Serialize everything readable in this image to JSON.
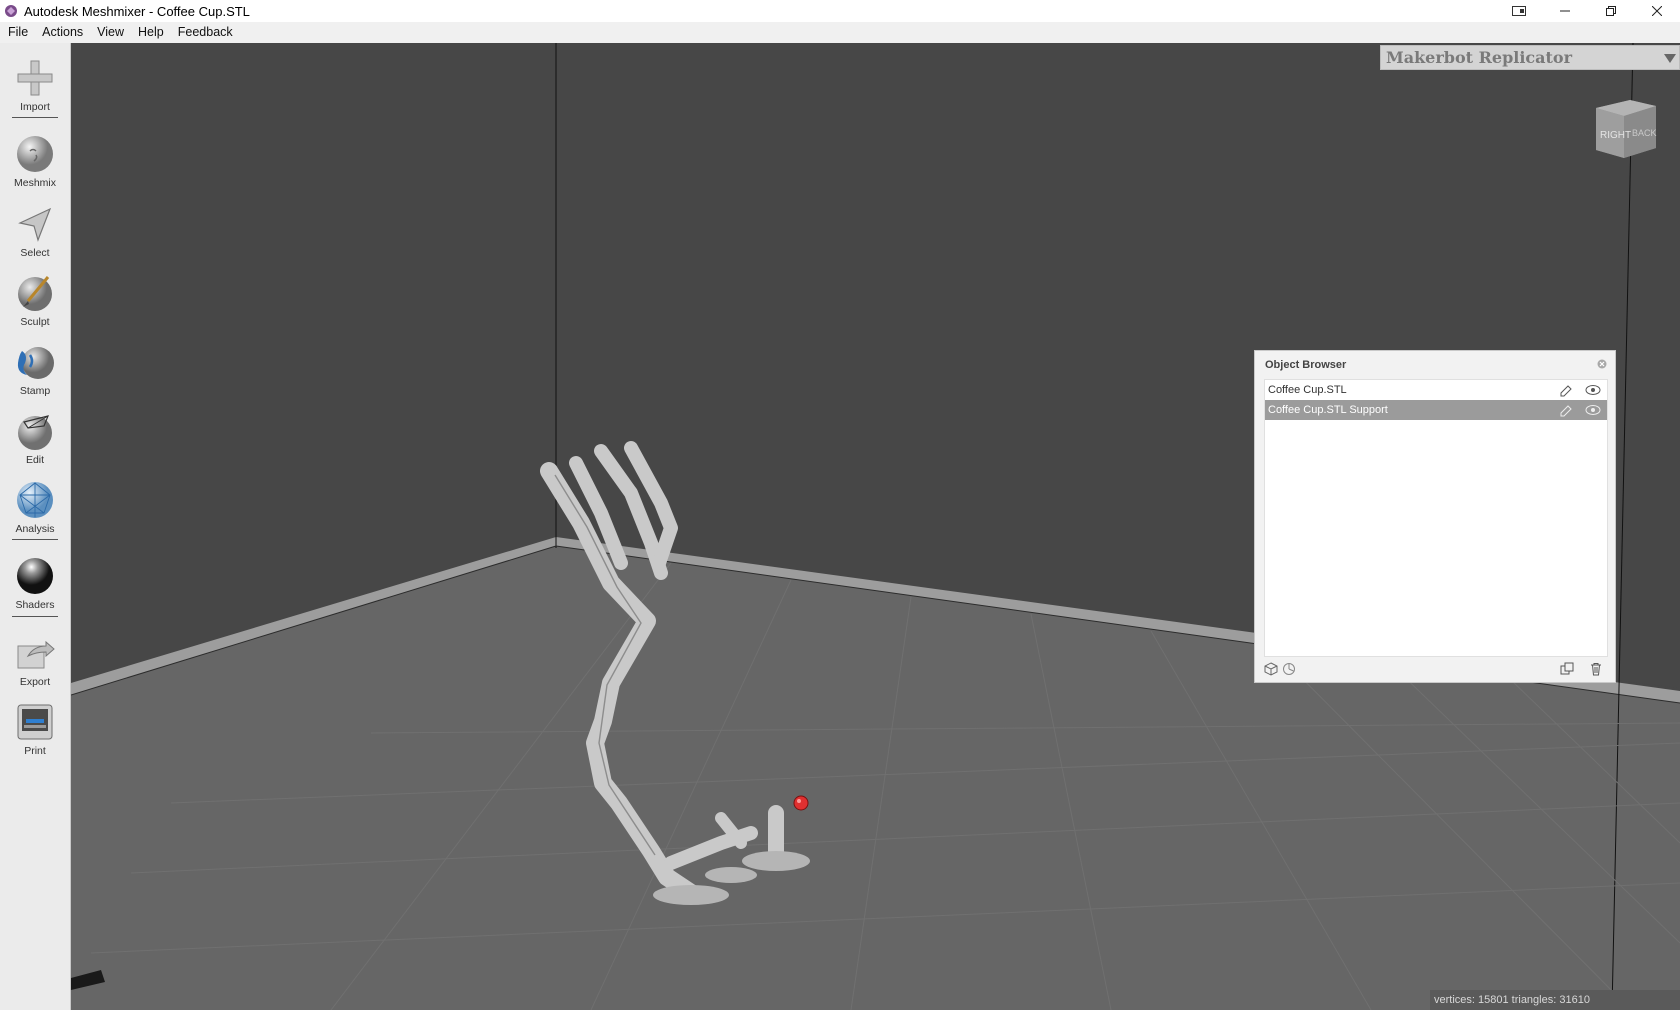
{
  "window": {
    "title": "Autodesk Meshmixer - Coffee Cup.STL"
  },
  "menu": [
    "File",
    "Actions",
    "View",
    "Help",
    "Feedback"
  ],
  "toolbar": {
    "tools": [
      {
        "label": "Import",
        "icon": "plus-icon"
      },
      {
        "label": "Meshmix",
        "icon": "meshmix-sphere-icon"
      },
      {
        "label": "Select",
        "icon": "cursor-arrow-icon"
      },
      {
        "label": "Sculpt",
        "icon": "sculpt-brush-icon"
      },
      {
        "label": "Stamp",
        "icon": "stamp-icon"
      },
      {
        "label": "Edit",
        "icon": "edit-sphere-icon"
      },
      {
        "label": "Analysis",
        "icon": "analysis-sphere-icon"
      },
      {
        "label": "Shaders",
        "icon": "shader-ball-icon"
      },
      {
        "label": "Export",
        "icon": "export-icon"
      },
      {
        "label": "Print",
        "icon": "printer-icon"
      }
    ]
  },
  "printer": {
    "selected": "Makerbot Replicator"
  },
  "viewcube": {
    "faces": [
      "RIGHT",
      "BACK"
    ]
  },
  "object_browser": {
    "title": "Object Browser",
    "objects": [
      {
        "name": "Coffee Cup.STL",
        "selected": false
      },
      {
        "name": "Coffee Cup.STL Support",
        "selected": true
      }
    ]
  },
  "status": {
    "text": "vertices: 15801 triangles: 31610"
  },
  "colors": {
    "viewport_background": "#474747",
    "floor": "#666666",
    "model": "#cfcfcf",
    "selection_row": "#9b9b9b",
    "pivot": "#e03030"
  }
}
